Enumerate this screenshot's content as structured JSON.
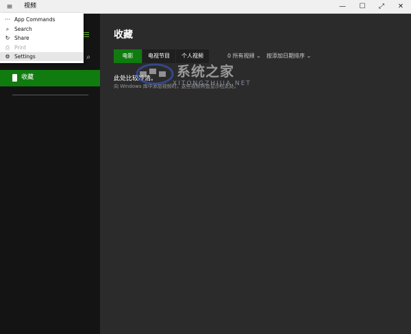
{
  "window": {
    "title": "视频",
    "icons": {
      "menu": "hamburger-icon",
      "minimize": "minimize-icon",
      "maximize": "maximize-icon",
      "fullscreen": "fullscreen-icon",
      "close": "close-icon"
    }
  },
  "app_menu": {
    "items": [
      {
        "label": "App Commands",
        "icon": "more-icon",
        "disabled": false
      },
      {
        "label": "Search",
        "icon": "search-icon",
        "disabled": false
      },
      {
        "label": "Share",
        "icon": "share-icon",
        "disabled": false
      },
      {
        "label": "Print",
        "icon": "print-icon",
        "disabled": true
      },
      {
        "label": "Settings",
        "icon": "gear-icon",
        "disabled": false
      }
    ]
  },
  "sidebar": {
    "active_item": {
      "label": "收藏",
      "icon": "collection-icon"
    },
    "accent": "#107c10"
  },
  "main": {
    "title": "收藏",
    "tabs": [
      {
        "label": "电影",
        "active": true
      },
      {
        "label": "电视节目",
        "active": false
      },
      {
        "label": "个人视频",
        "active": false
      }
    ],
    "filters": {
      "all_videos": "0 所有视频 ⌄",
      "sort": "按添加日期排序 ⌄"
    },
    "empty_title": "此处比较冷清。",
    "empty_desc": "向 Windows 库中添加视频时，这些视频将会显示在此处。"
  },
  "watermark": {
    "text": "系统之家",
    "sub": "XITONGZHIJIA.NET"
  }
}
